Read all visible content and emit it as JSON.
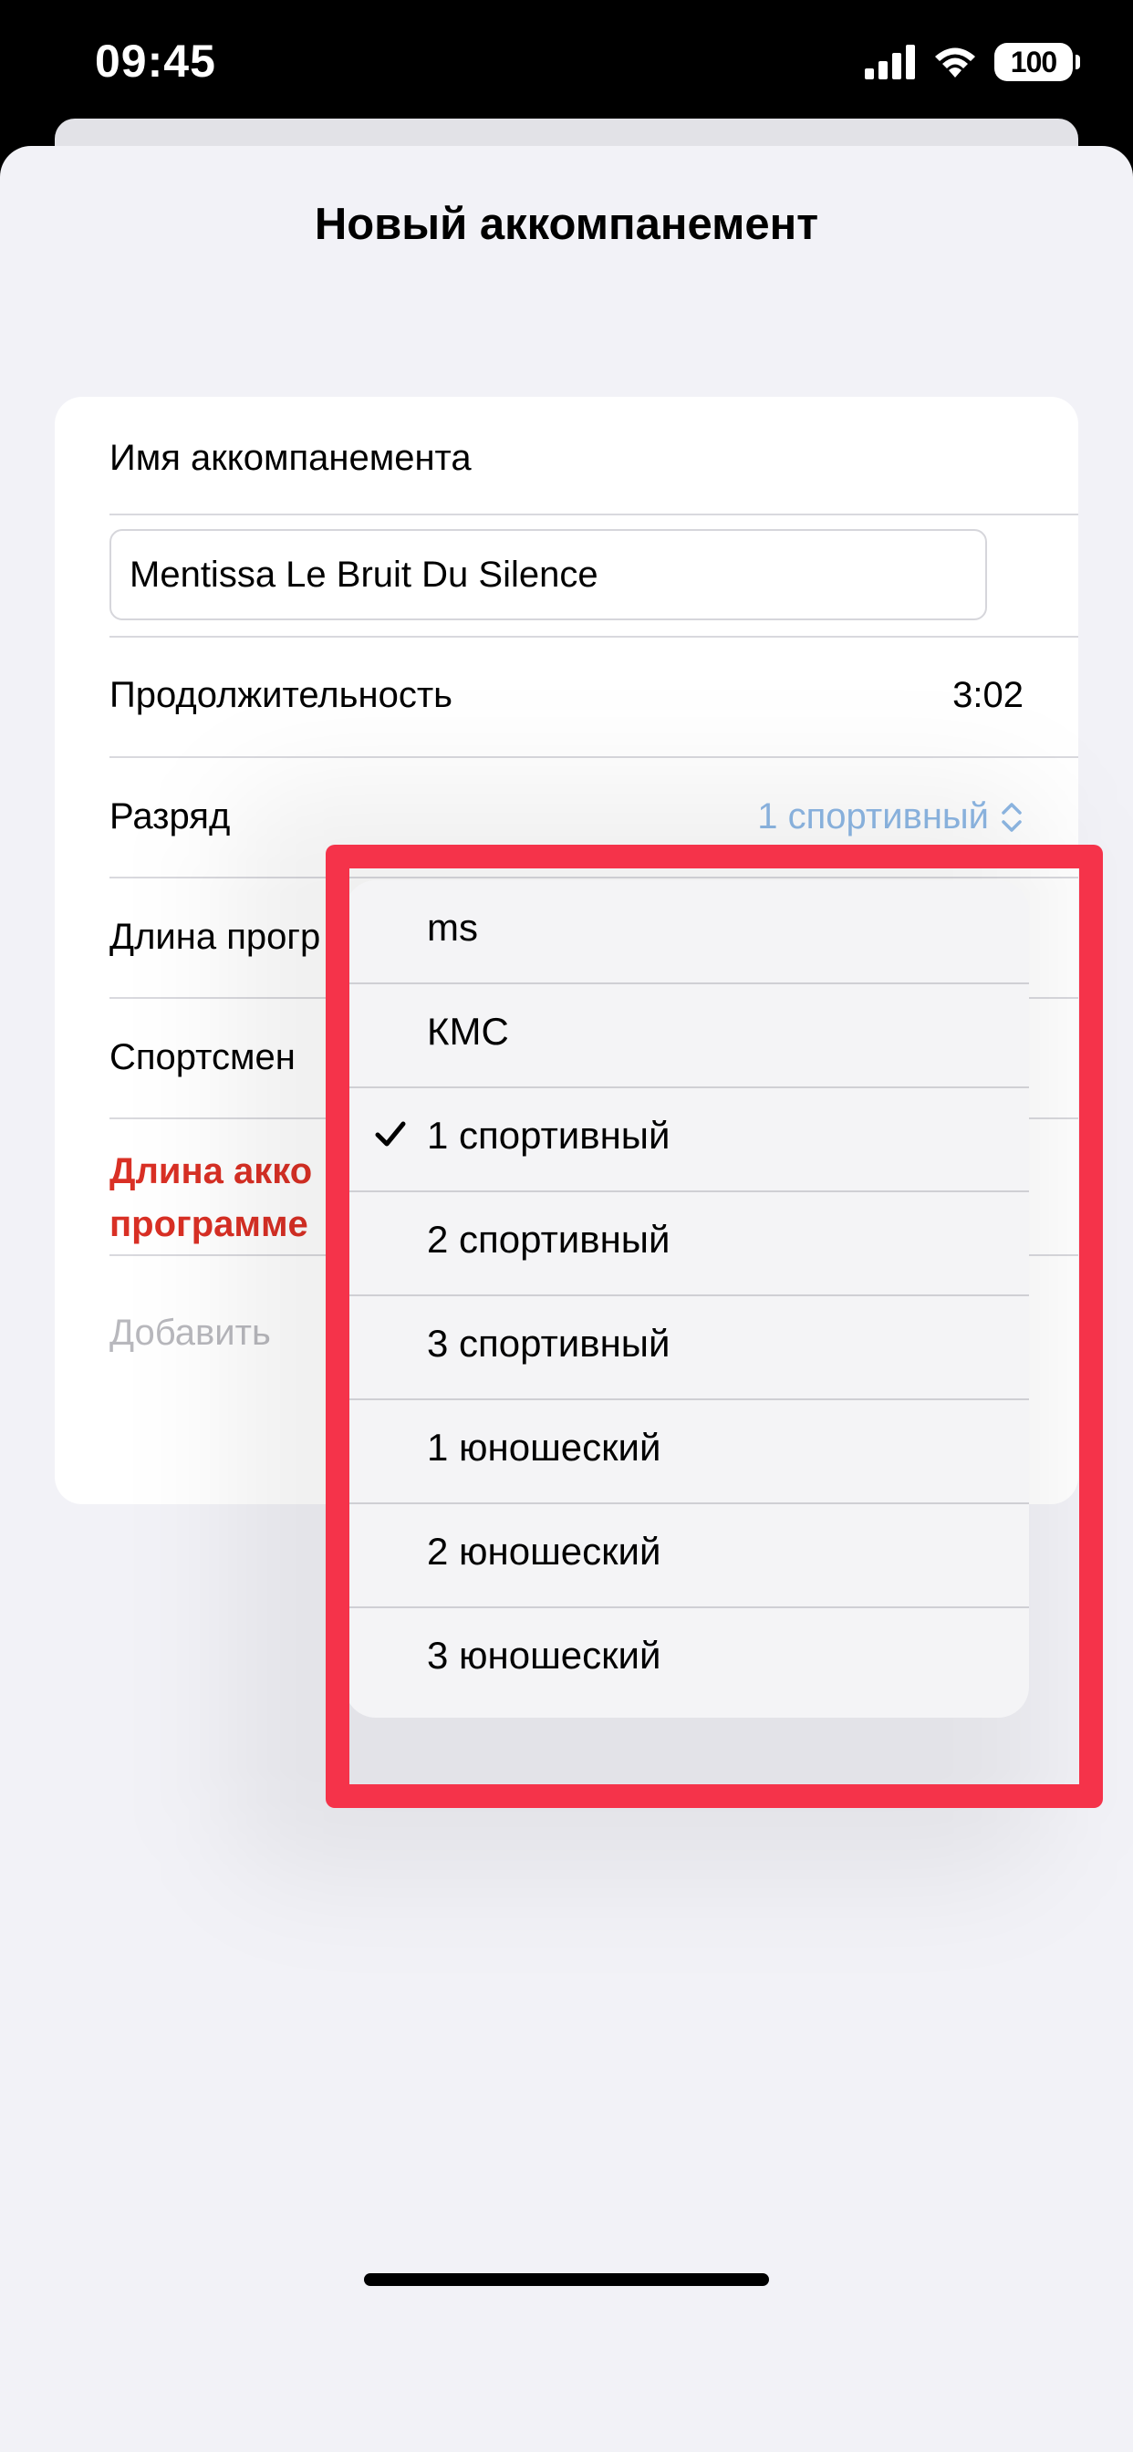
{
  "status_bar": {
    "time": "09:45",
    "battery": "100",
    "icons": [
      "signal-icon",
      "wifi-icon",
      "battery-icon"
    ]
  },
  "sheet": {
    "title": "Новый аккомпанемент"
  },
  "form": {
    "name_label": "Имя аккомпанемента",
    "name_value": "Mentissa Le Bruit Du Silence",
    "duration_label": "Продолжительность",
    "duration_value": "3:02",
    "rank_label": "Разряд",
    "rank_value": "1 спортивный",
    "program_length_label": "Длина прогр",
    "athlete_label": "Спортсмен",
    "error_line1": "Длина акко",
    "error_line2": "программе",
    "add_label": "Добавить"
  },
  "menu": {
    "items": [
      {
        "label": "ms",
        "selected": false
      },
      {
        "label": "КМС",
        "selected": false
      },
      {
        "label": "1 спортивный",
        "selected": true
      },
      {
        "label": "2 спортивный",
        "selected": false
      },
      {
        "label": "3 спортивный",
        "selected": false
      },
      {
        "label": "1 юношеский",
        "selected": false
      },
      {
        "label": "2 юношеский",
        "selected": false
      },
      {
        "label": "3 юношеский",
        "selected": false
      }
    ]
  },
  "colors": {
    "accent": "#8eb8e5",
    "error": "#d93025",
    "highlight": "#f5334a",
    "background": "#f2f2f7"
  }
}
